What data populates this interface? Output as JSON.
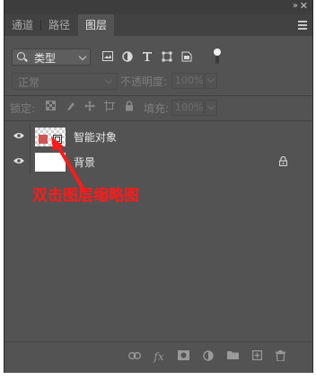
{
  "window": {
    "collapse_glyph": "»",
    "close_glyph": "✕"
  },
  "tabs": [
    {
      "label": "通道",
      "active": false
    },
    {
      "label": "路径",
      "active": false
    },
    {
      "label": "图层",
      "active": true
    }
  ],
  "filter": {
    "kind_label": "类型",
    "icons": [
      "image-filter-icon",
      "adjustment-filter-icon",
      "type-filter-icon",
      "shape-filter-icon",
      "smart-object-filter-icon"
    ]
  },
  "blend": {
    "mode": "正常",
    "opacity_label": "不透明度:",
    "opacity_value": "100%"
  },
  "lock": {
    "label": "锁定:",
    "fill_label": "填充:",
    "fill_value": "100%"
  },
  "layers": [
    {
      "name": "智能对象",
      "type": "smart-object",
      "visible": true,
      "locked": false
    },
    {
      "name": "背景",
      "type": "background",
      "visible": true,
      "locked": true
    }
  ],
  "annotation": {
    "text": "双击图层缩略图",
    "color": "#ff1a1a"
  },
  "bottom_icons": [
    "link-layers-icon",
    "fx-icon",
    "add-mask-icon",
    "adjustment-layer-icon",
    "new-group-icon",
    "new-layer-icon",
    "delete-icon"
  ],
  "colors": {
    "panel": "#535353",
    "tabbar": "#424242",
    "accent_red": "#ff1a1a"
  }
}
